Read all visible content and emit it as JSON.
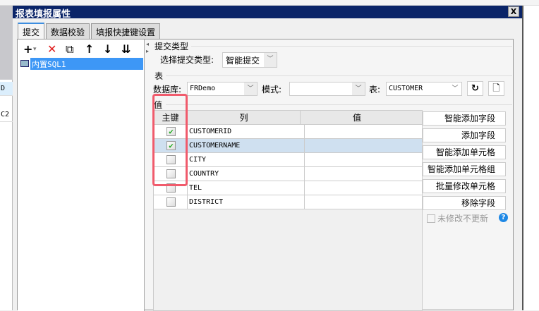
{
  "background": {
    "cells": [
      "D",
      "C2"
    ]
  },
  "dialog": {
    "title": "报表填报属性",
    "close": "X"
  },
  "tabs": [
    {
      "label": "提交"
    },
    {
      "label": "数据校验"
    },
    {
      "label": "填报快捷键设置"
    }
  ],
  "toolbar": {
    "add": "+",
    "add_dropdown": "▾",
    "delete": "✕",
    "copy": "⧉",
    "up": "↑",
    "down": "↓",
    "bottom": "⇊"
  },
  "tree": {
    "items": [
      "内置SQL1"
    ]
  },
  "submit_type": {
    "section": "提交类型",
    "label": "选择提交类型:",
    "value": "智能提交"
  },
  "table_section": {
    "section": "表",
    "db_label": "数据库:",
    "db_value": "FRDemo",
    "mode_label": "模式:",
    "mode_value": "",
    "table_label": "表:",
    "table_value": "CUSTOMER"
  },
  "value_section": {
    "section": "值",
    "columns": [
      "主键",
      "列",
      "值"
    ],
    "rows": [
      {
        "key": true,
        "column": "CUSTOMERID",
        "value": ""
      },
      {
        "key": true,
        "column": "CUSTOMERNAME",
        "value": ""
      },
      {
        "key": false,
        "column": "CITY",
        "value": ""
      },
      {
        "key": false,
        "column": "COUNTRY",
        "value": ""
      },
      {
        "key": false,
        "column": "TEL",
        "value": ""
      },
      {
        "key": false,
        "column": "DISTRICT",
        "value": ""
      }
    ]
  },
  "side_buttons": [
    "智能添加字段",
    "添加字段",
    "智能添加单元格",
    "智能添加单元格组",
    "批量修改单元格",
    "移除字段"
  ],
  "no_update_unmodified": {
    "label": "未修改不更新",
    "checked": false
  },
  "colors": {
    "title_bar": "#0a2468",
    "selection": "#3d97f6",
    "highlight": "#f05b6c",
    "check": "#22aa22"
  }
}
